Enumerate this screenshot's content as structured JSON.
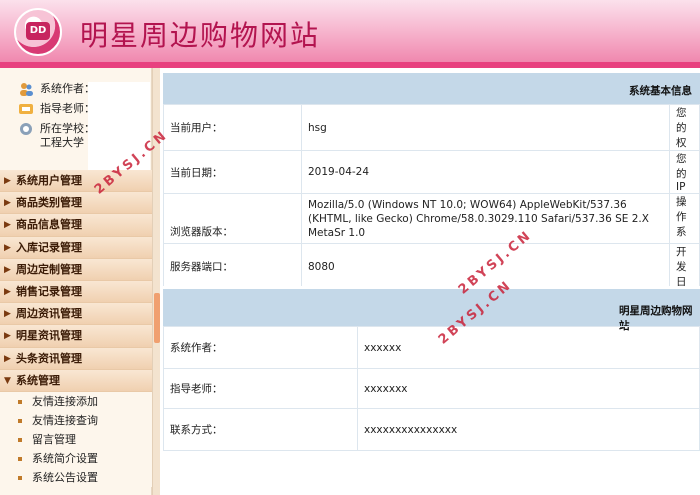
{
  "header": {
    "title": "明星周边购物网站",
    "logo_text": "DD"
  },
  "sidebar": {
    "info": [
      {
        "label": "系统作者："
      },
      {
        "label": "指导老师："
      },
      {
        "label": "所在学校：",
        "extra": "工程大学"
      }
    ],
    "menu": [
      "系统用户管理",
      "商品类别管理",
      "商品信息管理",
      "入库记录管理",
      "周边定制管理",
      "销售记录管理",
      "周边资讯管理",
      "明星资讯管理",
      "头条资讯管理",
      "系统管理"
    ],
    "submenu": [
      "友情连接添加",
      "友情连接查询",
      "留言管理",
      "系统简介设置",
      "系统公告设置"
    ]
  },
  "panel1": {
    "title": "系统基本信息",
    "rows": [
      {
        "label": "当前用户：",
        "value": "hsg",
        "right": "您的权"
      },
      {
        "label": "当前日期：",
        "value": "2019-04-24",
        "right": "您的IP"
      },
      {
        "label": "浏览器版本：",
        "value": "Mozilla/5.0 (Windows NT 10.0; WOW64) AppleWebKit/537.36 (KHTML, like Gecko) Chrome/58.0.3029.110 Safari/537.36 SE 2.X MetaSr 1.0",
        "right": "操作系"
      },
      {
        "label": "服务器端口：",
        "value": "8080",
        "right": "开发日"
      }
    ]
  },
  "panel2": {
    "title": "明星周边购物网站",
    "rows": [
      {
        "label": "系统作者：",
        "value": "xxxxxx"
      },
      {
        "label": "指导老师：",
        "value": "xxxxxxx"
      },
      {
        "label": "联系方式：",
        "value": "xxxxxxxxxxxxxxx"
      }
    ]
  },
  "watermarks": [
    "2BYSJ.CN",
    "2BYSJ.CN",
    "2BYSJ.CN"
  ],
  "colors": {
    "accent": "#e8407f",
    "title": "#b3144f",
    "panel_head": "#c4d8e8"
  }
}
